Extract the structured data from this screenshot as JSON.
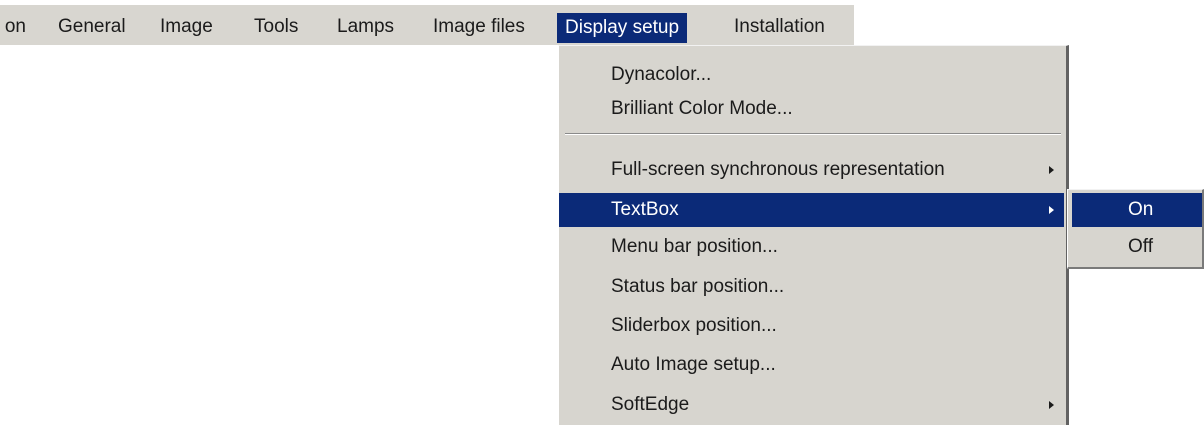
{
  "menubar": {
    "items": [
      {
        "label": "on"
      },
      {
        "label": "General"
      },
      {
        "label": "Image"
      },
      {
        "label": "Tools"
      },
      {
        "label": "Lamps"
      },
      {
        "label": "Image files"
      },
      {
        "label": "Display setup"
      },
      {
        "label": "Installation"
      }
    ],
    "active_item": "Display setup"
  },
  "dropdown": {
    "items": [
      {
        "label": "Dynacolor...",
        "has_submenu": false
      },
      {
        "label": "Brilliant Color Mode...",
        "has_submenu": false
      },
      {
        "label": "Full-screen synchronous representation",
        "has_submenu": true
      },
      {
        "label": "TextBox",
        "has_submenu": true,
        "highlighted": true
      },
      {
        "label": "Menu bar position...",
        "has_submenu": false
      },
      {
        "label": "Status bar position...",
        "has_submenu": false
      },
      {
        "label": "Sliderbox position...",
        "has_submenu": false
      },
      {
        "label": "Auto Image setup...",
        "has_submenu": false
      },
      {
        "label": "SoftEdge",
        "has_submenu": true
      }
    ]
  },
  "submenu": {
    "items": [
      {
        "label": "On",
        "highlighted": true
      },
      {
        "label": "Off"
      }
    ]
  },
  "colors": {
    "menu_background": "#d7d5cf",
    "highlight": "#0b2a78",
    "text": "#1b1b1b",
    "highlight_text": "#ffffff"
  }
}
